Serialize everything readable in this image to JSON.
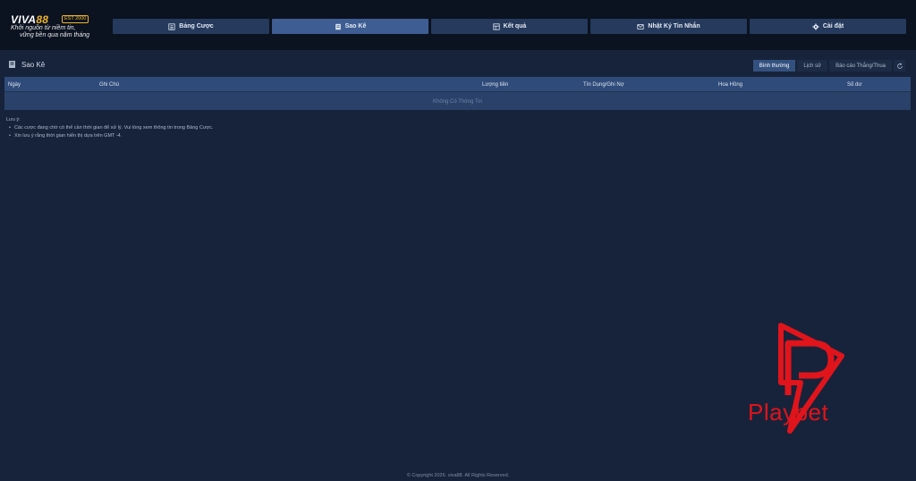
{
  "brand": {
    "logo_main": "VIVA",
    "logo_accent": "88",
    "logo_est": "EST 2000",
    "slogan_line1": "Khởi nguồn từ niềm tin,",
    "slogan_line2": "vững bền qua năm tháng"
  },
  "nav": {
    "items": [
      {
        "label": "Bảng Cược",
        "icon": "list-icon"
      },
      {
        "label": "Sao Kê",
        "icon": "statement-icon"
      },
      {
        "label": "Kết quả",
        "icon": "results-icon"
      },
      {
        "label": "Nhật Ký Tin Nhắn",
        "icon": "mail-icon"
      },
      {
        "label": "Cài đặt",
        "icon": "gear-icon"
      }
    ]
  },
  "page": {
    "title": "Sao Kê",
    "filters": [
      "Bình thường",
      "Lịch sử",
      "Báo cáo Thắng/Thua"
    ]
  },
  "table": {
    "headers": [
      "Ngày",
      "Ghi Chú",
      "Lượng tiền",
      "Tín Dụng/Ghi Nợ",
      "Hoa Hồng",
      "Số dư"
    ],
    "empty": "Không Có Thông Tin"
  },
  "notes": {
    "title": "Lưu ý:",
    "items": [
      "Các cược đang chờ có thể cần thời gian để xử lý. Vui lòng xem thông tin trong Bảng Cược.",
      "Xin lưu ý rằng thời gian hiển thị dựa trên GMT -4."
    ]
  },
  "watermark": {
    "text": "Playbet"
  },
  "footer": {
    "text": "© Copyright 2026. viva88. All Rights Reserved."
  },
  "colors": {
    "background": "#17233a",
    "header": "#0b1220",
    "nav_item": "#253a5c",
    "nav_active": "#3e5d93",
    "brand_accent": "#f0b52a",
    "watermark": "#e0141b"
  }
}
